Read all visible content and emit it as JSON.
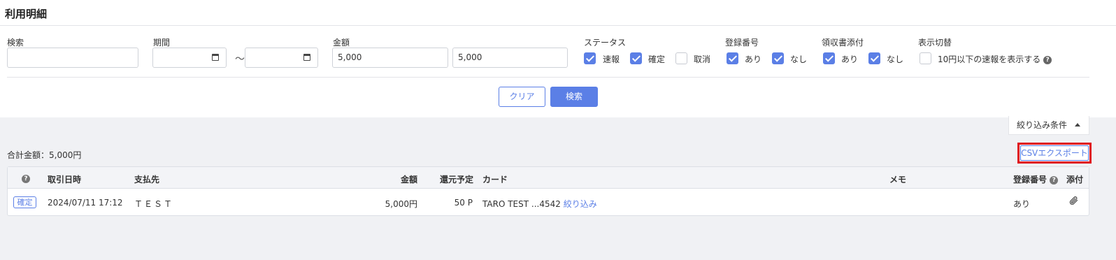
{
  "page_title": "利用明細",
  "filters": {
    "search": {
      "label": "検索",
      "value": ""
    },
    "period": {
      "label": "期間",
      "separator": "～"
    },
    "amount": {
      "label": "金額",
      "min": "5,000",
      "max": "5,000"
    },
    "status": {
      "label": "ステータス",
      "options": [
        {
          "label": "速報",
          "checked": true
        },
        {
          "label": "確定",
          "checked": true
        },
        {
          "label": "取消",
          "checked": false
        }
      ]
    },
    "registration": {
      "label": "登録番号",
      "options": [
        {
          "label": "あり",
          "checked": true
        },
        {
          "label": "なし",
          "checked": true
        }
      ]
    },
    "receipt": {
      "label": "領収書添付",
      "options": [
        {
          "label": "あり",
          "checked": true
        },
        {
          "label": "なし",
          "checked": true
        }
      ]
    },
    "display": {
      "label": "表示切替",
      "option": {
        "label": "10円以下の速報を表示する",
        "checked": false
      }
    },
    "clear_label": "クリア",
    "search_label": "検索"
  },
  "filter_toggle_label": "絞り込み条件",
  "total_label": "合計金額：5,000円",
  "csv_export_label": "CSVエクスポート",
  "table": {
    "headers": {
      "datetime": "取引日時",
      "payee": "支払先",
      "amount": "金額",
      "points": "還元予定",
      "card": "カード",
      "memo": "メモ",
      "registration": "登録番号",
      "attachment": "添付"
    },
    "rows": [
      {
        "status": "確定",
        "datetime": "2024/07/11 17:12",
        "payee": "ＴＥＳＴ",
        "amount": "5,000円",
        "points": "50 P",
        "card": "TARO TEST ...4542",
        "card_filter_link": "絞り込み",
        "memo": "",
        "registration": "あり"
      }
    ]
  },
  "colors": {
    "accent": "#5b7fe6",
    "highlight": "#e0101a",
    "background": "#f0f1f4"
  }
}
